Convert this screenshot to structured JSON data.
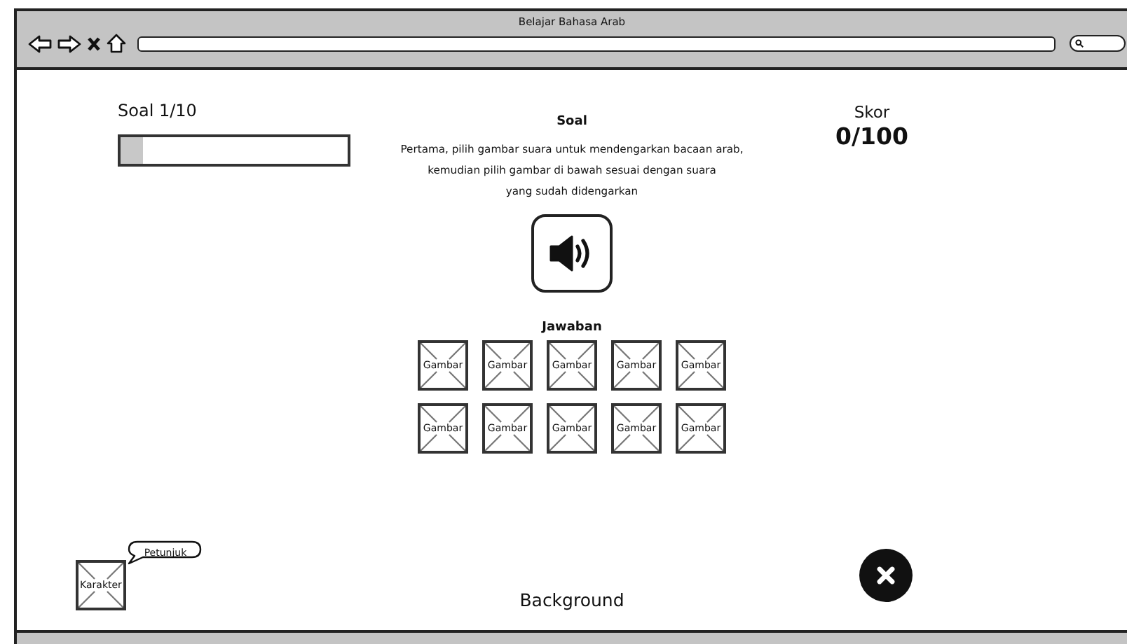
{
  "browser": {
    "title": "Belajar Bahasa Arab"
  },
  "question_counter": "Soal 1/10",
  "progress": {
    "level": 0.1
  },
  "score": {
    "label": "Skor",
    "value": "0/100"
  },
  "question": {
    "heading": "Soal",
    "instruction_lines": [
      "Pertama, pilih gambar suara untuk mendengarkan bacaan arab,",
      "kemudian pilih gambar di bawah sesuai dengan suara",
      "yang sudah didengarkan"
    ]
  },
  "answers": {
    "heading": "Jawaban",
    "options": [
      "Gambar",
      "Gambar",
      "Gambar",
      "Gambar",
      "Gambar",
      "Gambar",
      "Gambar",
      "Gambar",
      "Gambar",
      "Gambar"
    ]
  },
  "character": {
    "label": "Karakter",
    "hint": "Petunjuk"
  },
  "background_label": "Background"
}
